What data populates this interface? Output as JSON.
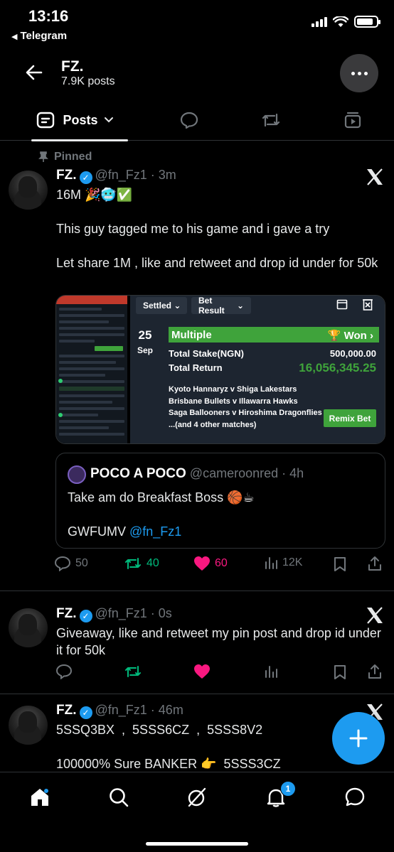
{
  "status": {
    "time": "13:16",
    "back_app": "Telegram"
  },
  "header": {
    "name": "FZ.",
    "posts_count": "7.9K posts"
  },
  "tabs": {
    "posts_label": "Posts"
  },
  "pinned_label": "Pinned",
  "posts": [
    {
      "author": "FZ.",
      "handle_time": "@fn_Fz1 · 3m",
      "text": "16M 🎉🥶✅\n\nThis guy tagged me to his game and i gave a try\n\nLet share 1M , like and retweet and drop id under for 50k",
      "replies": "50",
      "reposts": "40",
      "likes": "60",
      "views": "12K"
    },
    {
      "author": "FZ.",
      "handle_time": "@fn_Fz1 · 0s",
      "text": "Giveaway, like and retweet my pin post and drop id under it for 50k"
    },
    {
      "author": "FZ.",
      "handle_time": "@fn_Fz1 · 46m",
      "text": "5SSQ3BX  ,  5SSS6CZ  ,  5SSS8V2\n\n100000% Sure BANKER 👉  5SSS3CZ"
    }
  ],
  "bet_slip": {
    "tab_settled": "Settled",
    "tab_result": "Bet Result",
    "day": "25",
    "month": "Sep",
    "type": "Multiple",
    "status": "Won",
    "stake_label": "Total Stake(NGN)",
    "stake_value": "500,000.00",
    "return_label": "Total Return",
    "return_value": "16,056,345.25",
    "matches": [
      "Kyoto Hannaryz v Shiga Lakestars",
      "Brisbane Bullets v Illawarra Hawks",
      "Saga Ballooners v Hiroshima Dragonflies",
      "...(and 4 other matches)"
    ],
    "remix": "Remix Bet"
  },
  "quote": {
    "author": "POCO A POCO",
    "handle_time": "@cameroonred · 4h",
    "line1": "Take am do Breakfast Boss 🏀☕",
    "code": "GWFUMV",
    "mention": "@fn_Fz1"
  },
  "nav": {
    "notifications_badge": "1"
  },
  "colors": {
    "accent": "#1d9bf0",
    "like": "#f91880",
    "repost": "#00ba7c",
    "win_green": "#3fa33b"
  }
}
